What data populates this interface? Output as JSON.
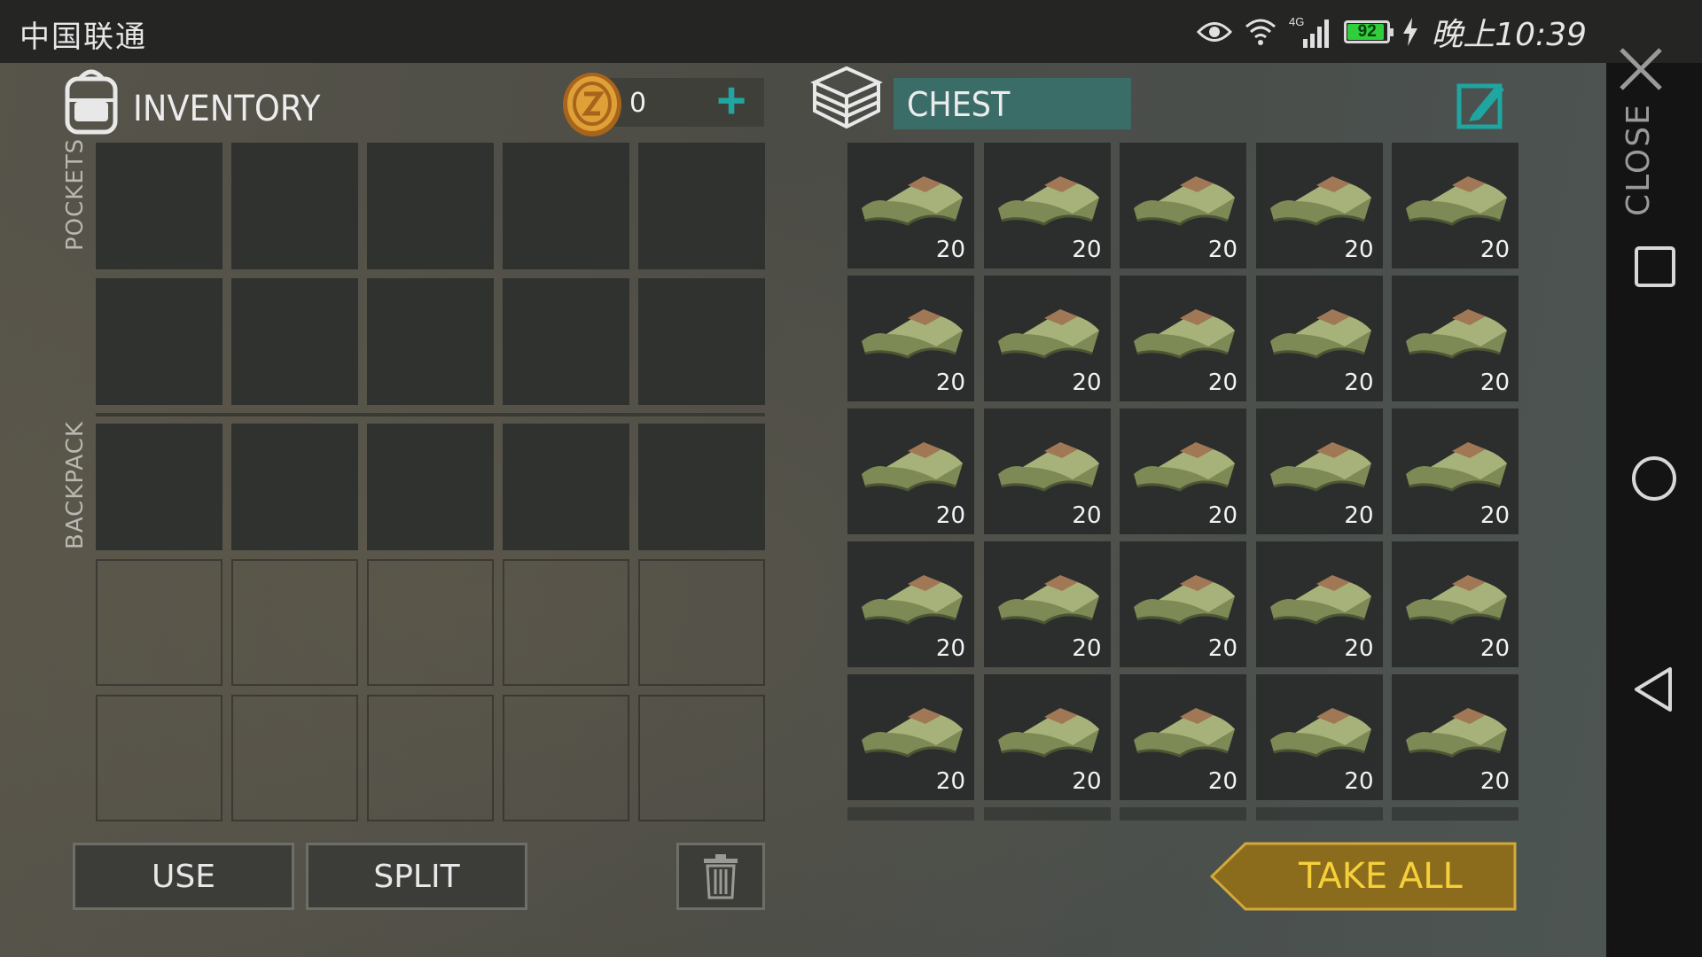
{
  "status_bar": {
    "carrier": "中国联通",
    "network": "4G",
    "battery": "92",
    "battery_level": 0.92,
    "time": "晚上10:39",
    "icons": [
      "eye-icon",
      "wifi-icon",
      "signal-icon",
      "battery-icon",
      "charging-icon"
    ]
  },
  "inventory": {
    "title": "INVENTORY",
    "coins": "0",
    "add_coins": "+",
    "pockets_label": "POCKETS",
    "backpack_label": "BACKPACK"
  },
  "chest": {
    "title": "CHEST",
    "item_name_icon": "cloth-icon",
    "item_count": "20",
    "visible_rows": 5,
    "columns": 5
  },
  "buttons": {
    "use": "USE",
    "split": "SPLIT",
    "take_all": "TAKE ALL"
  },
  "nav": {
    "close_label": "CLOSE"
  },
  "colors": {
    "accent_teal": "#3a6c68",
    "take_all_bg": "#8a6c1c",
    "take_all_text": "#f6d03a",
    "battery_green": "#2ecf3a"
  }
}
